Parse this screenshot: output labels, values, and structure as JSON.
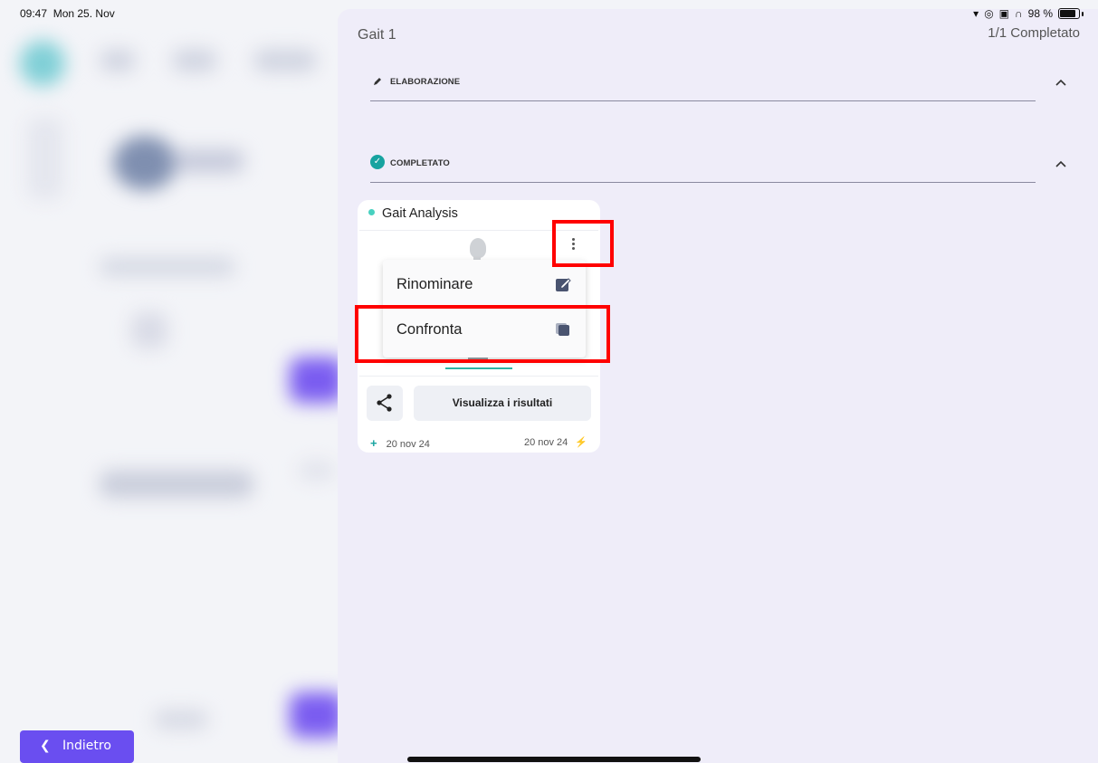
{
  "status_bar": {
    "time": "09:47",
    "date": "Mon 25. Nov",
    "battery": "98 %"
  },
  "panel": {
    "title": "Gait 1",
    "status": "1/1 Completato"
  },
  "sections": {
    "processing_label": "ELABORAZIONE",
    "completed_label": "COMPLETATO"
  },
  "card": {
    "title": "Gait Analysis",
    "results_button": "Visualizza i risultati",
    "created_date": "20 nov 24",
    "updated_date": "20 nov 24"
  },
  "menu": {
    "rename": "Rinominare",
    "compare": "Confronta"
  },
  "footer": {
    "back_label": "Indietro"
  },
  "colors": {
    "accent": "#6a4ef0",
    "teal": "#17a3a0",
    "highlight": "#ff0000"
  }
}
